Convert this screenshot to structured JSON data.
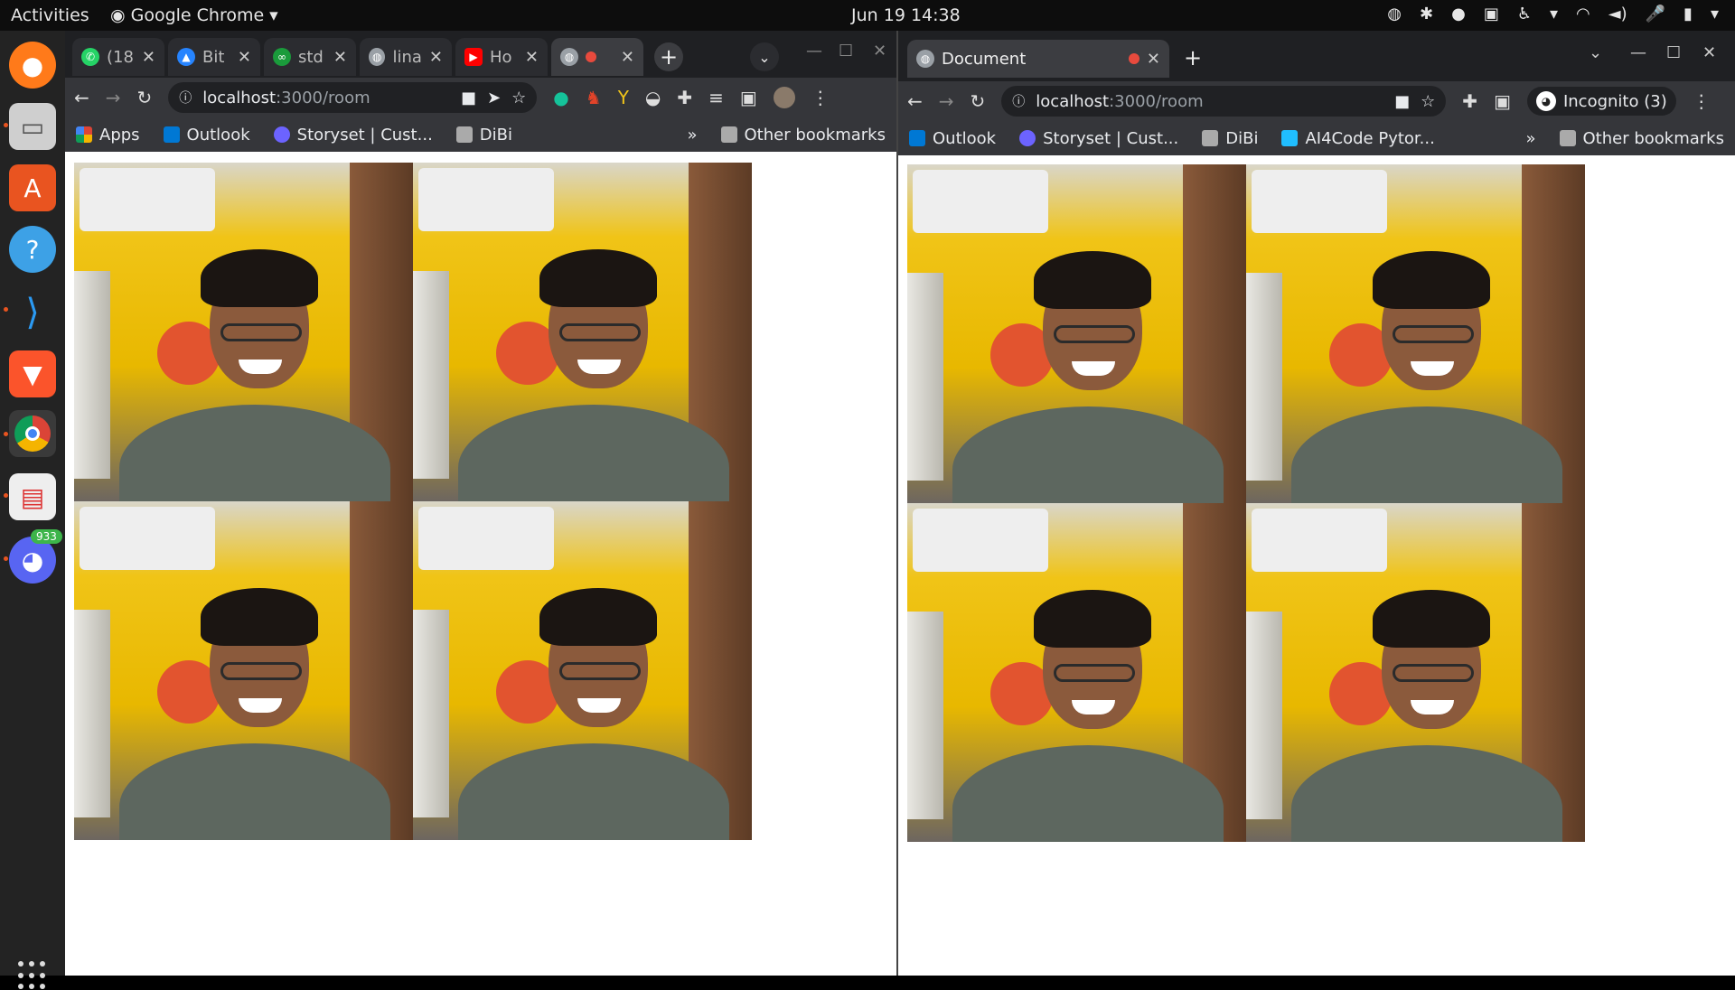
{
  "topbar": {
    "activities": "Activities",
    "app_name": "Google Chrome",
    "clock": "Jun 19  14:38"
  },
  "dock": {
    "discord_badge": "933"
  },
  "left_window": {
    "tabs": [
      {
        "label": "(18",
        "favicon": "whatsapp-icon",
        "color": "#25d366"
      },
      {
        "label": "Bit",
        "favicon": "bitbucket-icon",
        "color": "#2684ff"
      },
      {
        "label": "std",
        "favicon": "codeforces-icon",
        "color": "#1a9b3b"
      },
      {
        "label": "lina",
        "favicon": "globe-icon",
        "color": "#9aa0a6"
      },
      {
        "label": "Ho",
        "favicon": "youtube-icon",
        "color": "#ff0000"
      },
      {
        "label": "",
        "favicon": "globe-icon",
        "color": "#9aa0a6"
      }
    ],
    "url_host": "localhost",
    "url_path": ":3000/room",
    "bookmarks": [
      {
        "label": "Apps",
        "icon": "apps-grid-icon",
        "color": "#4285f4"
      },
      {
        "label": "Outlook",
        "icon": "outlook-icon",
        "color": "#0078d4"
      },
      {
        "label": "Storyset | Cust...",
        "icon": "storyset-icon",
        "color": "#6c63ff"
      },
      {
        "label": "DiBi",
        "icon": "folder-icon",
        "color": "#aaaaaa"
      }
    ],
    "more_bookmarks": "»",
    "other_bookmarks": "Other bookmarks"
  },
  "right_window": {
    "tab_title": "Document",
    "url_host": "localhost",
    "url_path": ":3000/room",
    "profile": "Incognito (3)",
    "bookmarks": [
      {
        "label": "Outlook",
        "icon": "outlook-icon",
        "color": "#0078d4"
      },
      {
        "label": "Storyset | Cust...",
        "icon": "storyset-icon",
        "color": "#6c63ff"
      },
      {
        "label": "DiBi",
        "icon": "folder-icon",
        "color": "#aaaaaa"
      },
      {
        "label": "AI4Code Pytor...",
        "icon": "kaggle-icon",
        "color": "#20beff"
      }
    ],
    "more_bookmarks": "»",
    "other_bookmarks": "Other bookmarks"
  }
}
